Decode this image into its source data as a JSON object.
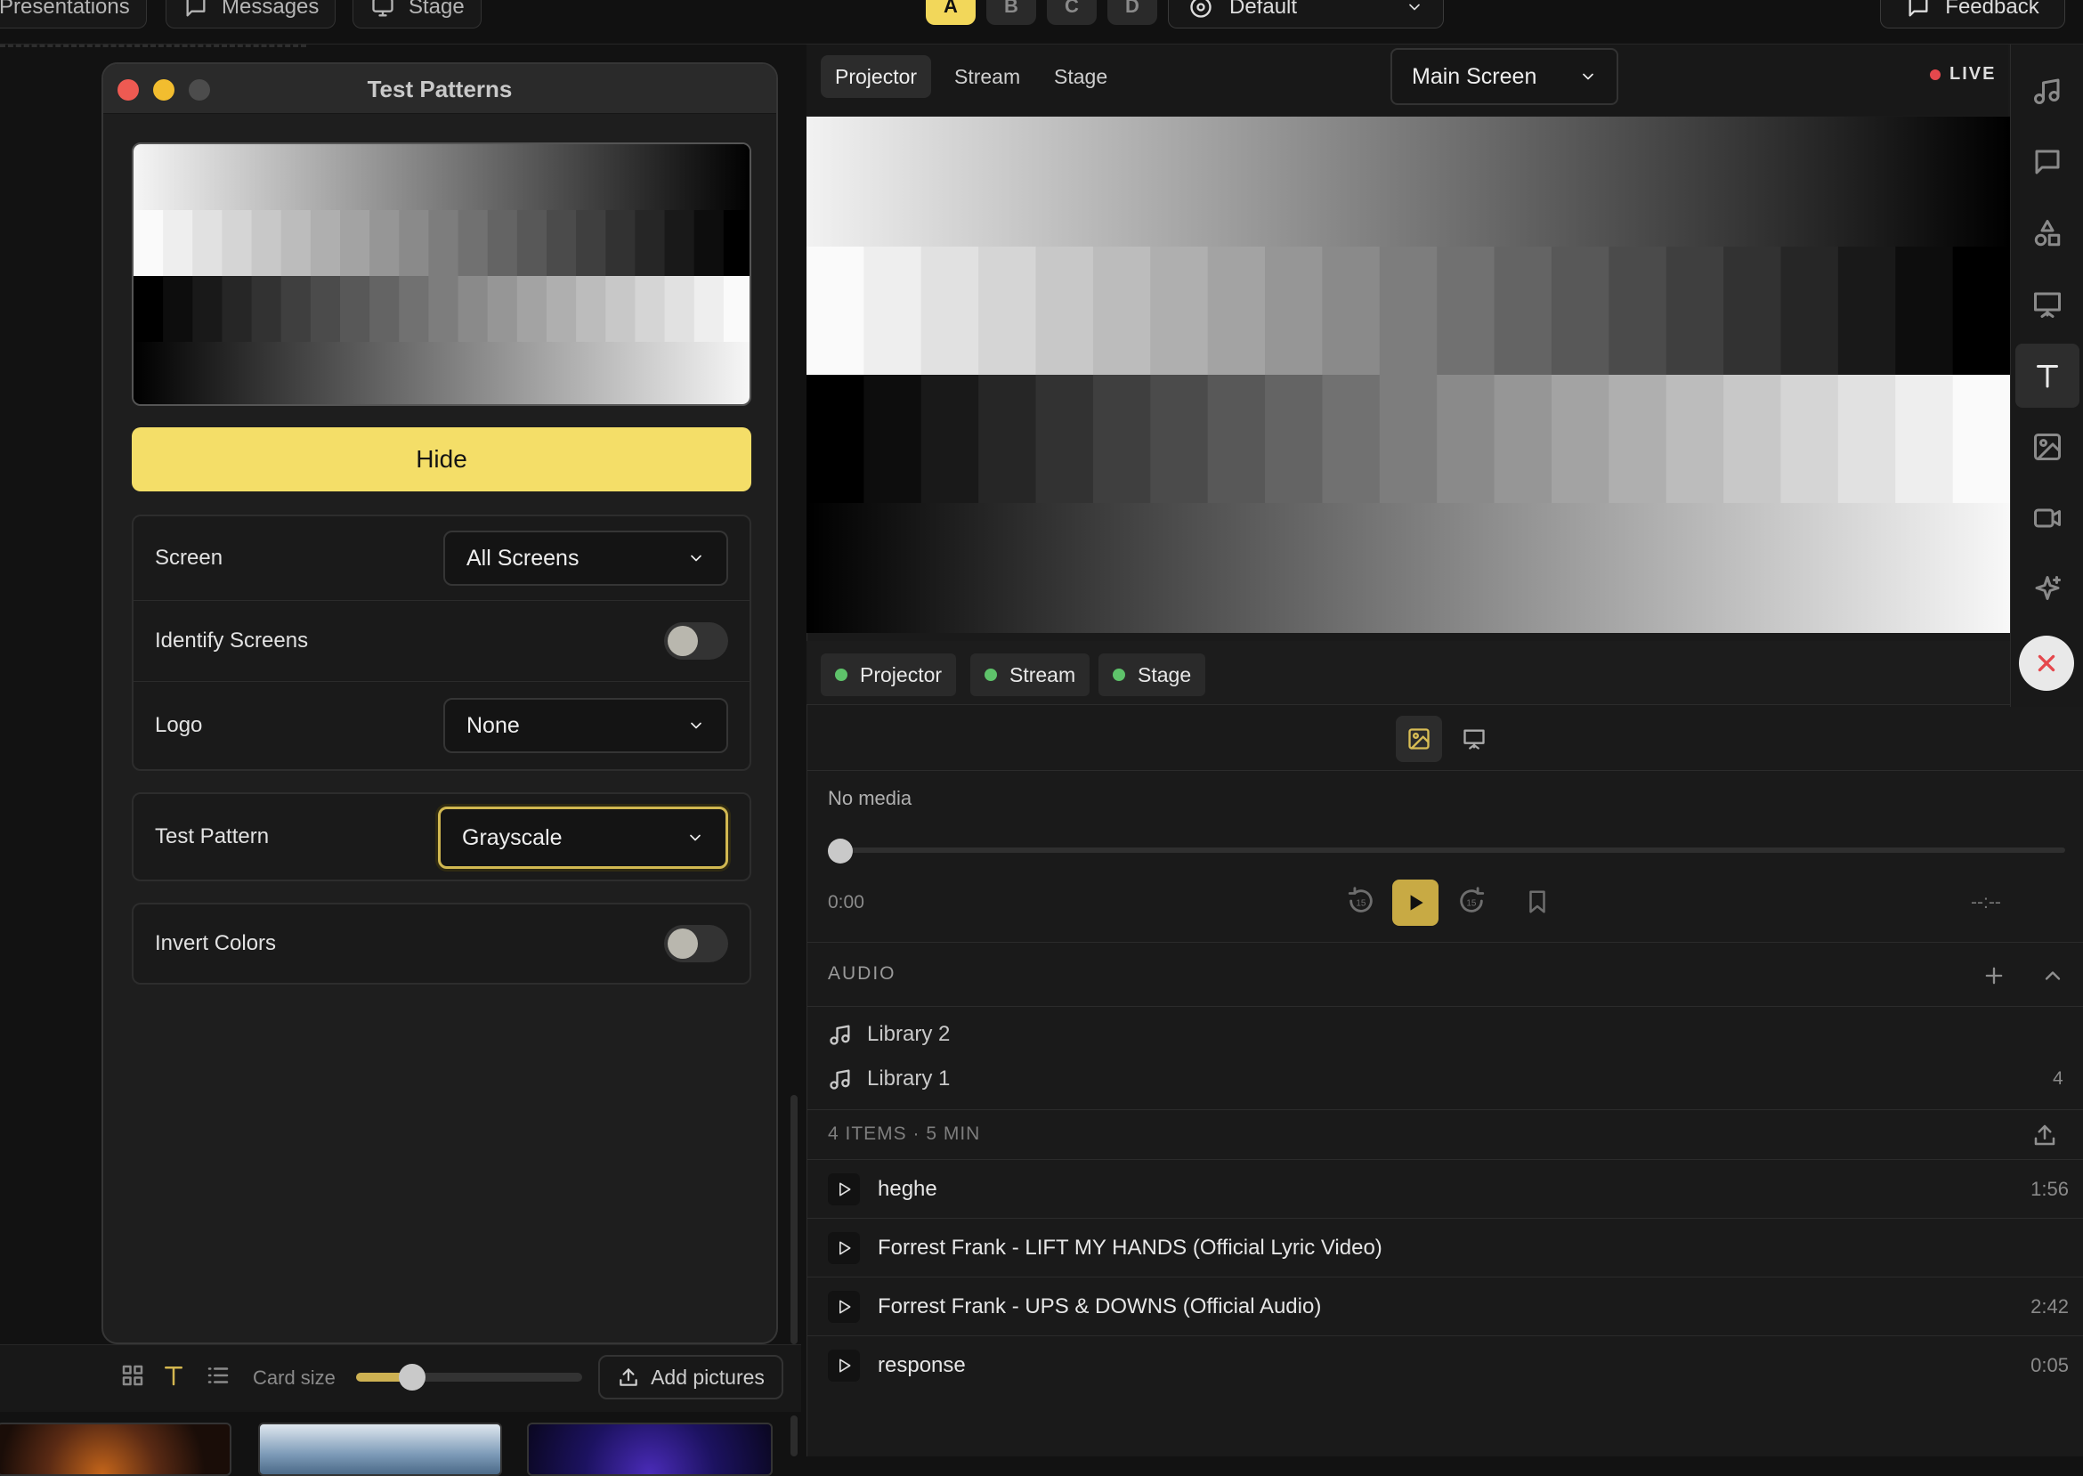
{
  "top_nav": {
    "tabs": [
      {
        "label": "Presentations",
        "icon": "presentation-icon"
      },
      {
        "label": "Messages",
        "icon": "message-icon"
      },
      {
        "label": "Stage",
        "icon": "monitor-icon"
      }
    ],
    "layers": [
      "A",
      "B",
      "C",
      "D"
    ],
    "active_layer": "A",
    "look_select": "Default",
    "feedback_label": "Feedback"
  },
  "test_patterns": {
    "window_title": "Test Patterns",
    "hide_label": "Hide",
    "screen_label": "Screen",
    "screen_value": "All Screens",
    "identify_label": "Identify Screens",
    "identify_on": false,
    "logo_label": "Logo",
    "logo_value": "None",
    "pattern_label": "Test Pattern",
    "pattern_value": "Grayscale",
    "invert_label": "Invert Colors",
    "invert_on": false
  },
  "left_toolbar": {
    "card_size_label": "Card size",
    "card_size_level": 0.25,
    "add_pictures_label": "Add pictures"
  },
  "preview": {
    "tabs": [
      "Projector",
      "Stream",
      "Stage"
    ],
    "active_tab": "Projector",
    "screen_select": "Main Screen",
    "live_label": "LIVE",
    "outputs": [
      "Projector",
      "Stream",
      "Stage"
    ],
    "live_color": "#e5484d",
    "output_dot_color": "#5ec26a"
  },
  "media": {
    "no_media": "No media",
    "time_start": "0:00",
    "time_end": "--:--",
    "accent_color": "#c8aa44"
  },
  "audio": {
    "header": "AUDIO",
    "libraries": [
      {
        "name": "Library 2",
        "count": ""
      },
      {
        "name": "Library 1",
        "count": "4"
      }
    ],
    "summary": "4 ITEMS · 5 MIN",
    "tracks": [
      {
        "name": "heghe",
        "duration": "1:56"
      },
      {
        "name": "Forrest Frank - LIFT MY HANDS (Official Lyric Video)",
        "duration": ""
      },
      {
        "name": "Forrest Frank - UPS & DOWNS (Official Audio)",
        "duration": "2:42"
      },
      {
        "name": "response",
        "duration": "0:05"
      }
    ]
  },
  "brand_color": "#f4de68"
}
